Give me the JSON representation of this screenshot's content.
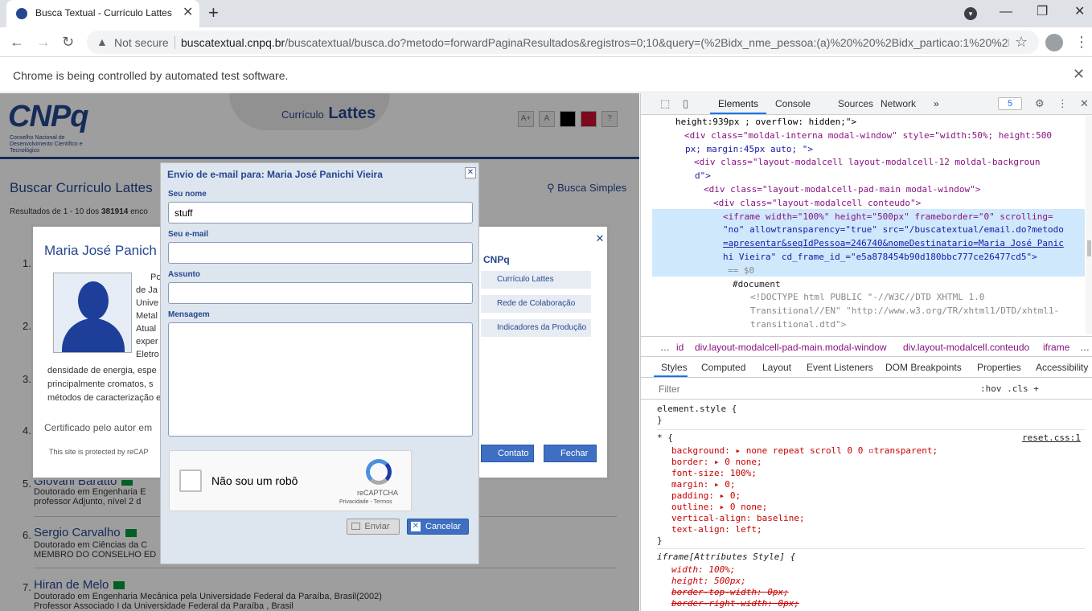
{
  "browser": {
    "tab_title": "Busca Textual - Currículo Lattes",
    "tab_close": "✕",
    "new_tab": "+",
    "not_secure": "Not secure",
    "url_host": "buscatextual.cnpq.br",
    "url_path": "/buscatextual/busca.do?metodo=forwardPaginaResultados&registros=0;10&query=(%2Bidx_nme_pessoa:(a)%20%20%2Bidx_particao:1%20%2Bid...",
    "infobar_text": "Chrome is being controlled by automated test software.",
    "icons": {
      "back": "←",
      "forward": "→",
      "reload": "↻",
      "warning": "▲",
      "star": "☆",
      "menu": "⋮",
      "minimize": "—",
      "restore": "❐",
      "close": "✕",
      "tab_search": "▾"
    }
  },
  "page": {
    "brand_sub": "Conselho Nacional de Desenvolvimento Científico e Tecnológico",
    "lattes_prefix": "Currículo",
    "lattes_word": "Lattes",
    "header_buttons": [
      "A+",
      "A",
      "",
      "",
      "?"
    ],
    "search_title": "Buscar Currículo Lattes",
    "search_simple": "Busca Simples",
    "results_prefix": "Resultados de 1 - 10 dos",
    "results_total": "381914",
    "results_suffix": "enco",
    "results": [
      {
        "num": "1.",
        "name": "",
        "lines": []
      },
      {
        "num": "2.",
        "name": "",
        "lines": []
      },
      {
        "num": "3.",
        "name": "",
        "lines": []
      },
      {
        "num": "4.",
        "name": "",
        "lines": []
      },
      {
        "num": "5.",
        "name": "Giovani Baratto",
        "lines": [
          "Doutorado em Engenharia E",
          "professor Adjunto, nível 2 d"
        ]
      },
      {
        "num": "6.",
        "name": "Sergio Carvalho",
        "lines": [
          "Doutorado em Ciências da C",
          "MEMBRO DO CONSELHO ED"
        ]
      },
      {
        "num": "7.",
        "name": "Hiran de Melo",
        "lines": [
          "Doutorado em Engenharia Mecânica pela Universidade Federal da Paraíba, Brasil(2002)",
          "Professor Associado I da Universidade Federal da Paraíba , Brasil"
        ]
      }
    ]
  },
  "outer_modal": {
    "close": "✕",
    "name": "Maria José Panich",
    "bio_lines": [
      "Po",
      "de Ja",
      "Unive",
      "Metal",
      "Atual",
      "exper",
      "Eletro"
    ],
    "bio_full_lines": [
      "densidade de energia, espe",
      "principalmente cromatos, s",
      "métodos de caracterização e"
    ],
    "side_title": "CNPq",
    "side_links": [
      "Currículo Lattes",
      "Rede de Colaboração",
      "Indicadores da Produção"
    ],
    "certified": "Certificado pelo autor em",
    "recaptcha_note": "This site is protected by reCAP",
    "btn_contato": "Contato",
    "btn_fechar": "Fechar"
  },
  "email_modal": {
    "title": "Envio de e-mail para: Maria José Panichi Vieira",
    "close": "✕",
    "label_name": "Seu nome",
    "value_name": "stuff",
    "label_email": "Seu e-mail",
    "value_email": "",
    "label_subject": "Assunto",
    "value_subject": "",
    "label_message": "Mensagem",
    "value_message": "",
    "recaptcha_label": "Não sou um robô",
    "recaptcha_brand": "reCAPTCHA",
    "recaptcha_links": "Privacidade - Termos",
    "btn_send": "Enviar",
    "btn_cancel": "Cancelar"
  },
  "devtools": {
    "tabs": [
      "Elements",
      "Console",
      "Sources",
      "Network"
    ],
    "more": "»",
    "badge": "5",
    "dom_lines": [
      "height:939px ; overflow: hidden;\">",
      "<div class=\"moldal-interna modal-window\" style=\"width:50%; height:500",
      "px; margin:45px auto; \">",
      "<div class=\"layout-modalcell layout-modalcell-12 moldal-backgroun",
      "d\">",
      "<div class=\"layout-modalcell-pad-main modal-window\">",
      "<div class=\"layout-modalcell conteudo\">",
      "<iframe width=\"100%\" height=\"500px\" frameborder=\"0\" scrolling=",
      "\"no\" allowtransparency=\"true\" src=\"/buscatextual/email.do?metodo",
      "=apresentar&seqIdPessoa=246740&nomeDestinatario=Maria José Panic",
      "hi Vieira\" cd_frame_id_=\"e5a878454b90d180bbc777ce26477cd5\">",
      "== $0",
      "#document",
      "<!DOCTYPE html PUBLIC \"-//W3C//DTD XHTML 1.0",
      "Transitional//EN\" \"http://www.w3.org/TR/xhtml1/DTD/xhtml1-",
      "transitional.dtd\">"
    ],
    "breadcrumbs": [
      "…",
      "id",
      "div.layout-modalcell-pad-main.modal-window",
      "div.layout-modalcell.conteudo",
      "iframe",
      "…"
    ],
    "subtabs": [
      "Styles",
      "Computed",
      "Layout",
      "Event Listeners",
      "DOM Breakpoints",
      "Properties",
      "Accessibility"
    ],
    "filter_placeholder": "Filter",
    "filter_right": ":hov  .cls  +",
    "styles": [
      "element.style {",
      "}",
      "* {",
      "background: ▸ none repeat scroll 0 0 ▫transparent;",
      "border: ▸ 0 none;",
      "font-size: 100%;",
      "margin: ▸ 0;",
      "padding: ▸ 0;",
      "outline: ▸ 0 none;",
      "vertical-align: baseline;",
      "text-align: left;",
      "}",
      "iframe[Attributes Style] {",
      "width: 100%;",
      "height: 500px;",
      "border-top-width: 0px;",
      "border-right-width: 0px;"
    ],
    "style_source": "reset.css:1"
  }
}
